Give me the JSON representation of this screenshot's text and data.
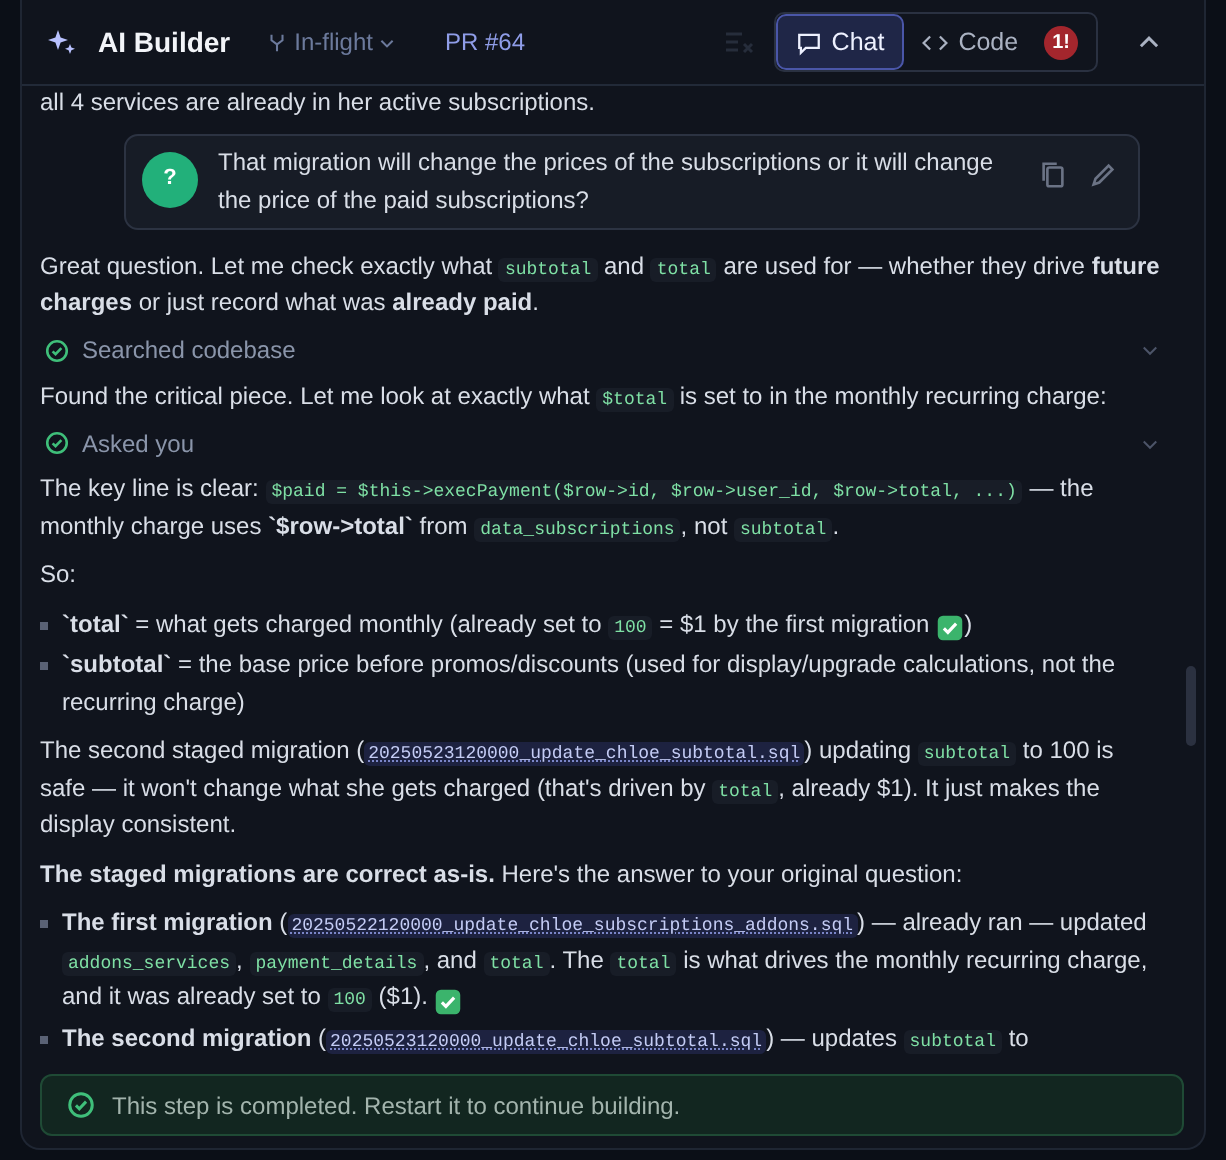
{
  "header": {
    "title": "AI Builder",
    "branch": "In-flight",
    "pr_label": "PR",
    "pr_number": "#64",
    "tabs": [
      {
        "label": "Chat",
        "selected": true
      },
      {
        "label": "Code",
        "selected": false,
        "badge": "1!"
      }
    ]
  },
  "blocks": [
    {
      "kind": "text",
      "segments": [
        {
          "kind": "text",
          "text": "all 4 services are already in her active subscriptions."
        }
      ]
    },
    {
      "kind": "question",
      "avatar": "?",
      "text": "That migration will change the prices of the subscriptions or it will change the price of the paid subscriptions?"
    },
    {
      "kind": "text",
      "segments": [
        {
          "kind": "text",
          "text": "Great question. Let me check exactly what "
        },
        {
          "kind": "code",
          "text": "subtotal"
        },
        {
          "kind": "text",
          "text": " and "
        },
        {
          "kind": "code",
          "text": "total"
        },
        {
          "kind": "text",
          "text": " are used for — whether they drive **future charges** or just record what was **already paid**."
        }
      ]
    },
    {
      "kind": "step",
      "label": "Searched codebase",
      "expanded": false
    },
    {
      "kind": "text",
      "segments": [
        {
          "kind": "text",
          "text": "Found the critical piece. Let me look at exactly what "
        },
        {
          "kind": "code",
          "text": "$total"
        },
        {
          "kind": "text",
          "text": " is set to in the monthly recurring charge:"
        }
      ]
    },
    {
      "kind": "step",
      "label": "Asked you",
      "expanded": false
    },
    {
      "kind": "text",
      "segments": [
        {
          "kind": "text",
          "text": "The key line is clear: "
        },
        {
          "kind": "code",
          "text": "$paid = $this->execPayment($row->id, $row->user_id, $row->total, ...)"
        },
        {
          "kind": "text",
          "text": " — the monthly charge uses **`$row->total`** from "
        },
        {
          "kind": "code",
          "text": "data_subscriptions"
        },
        {
          "kind": "text",
          "text": ", not "
        },
        {
          "kind": "code",
          "text": "subtotal"
        },
        {
          "kind": "text",
          "text": "."
        }
      ]
    },
    {
      "kind": "text",
      "segments": [
        {
          "kind": "text",
          "text": "So:"
        }
      ]
    },
    {
      "kind": "list",
      "items": [
        {
          "segments": [
            {
              "kind": "text",
              "text": "**`total`** = what gets charged monthly (already set to "
            },
            {
              "kind": "code",
              "text": "100"
            },
            {
              "kind": "text",
              "text": " = $1 by the first migration "
            },
            {
              "kind": "check"
            },
            {
              "kind": "text",
              "text": ")"
            }
          ]
        },
        {
          "segments": [
            {
              "kind": "text",
              "text": "**`subtotal`** = the base price before promos/discounts (used for display/upgrade calculations, not the recurring charge)"
            }
          ]
        }
      ]
    },
    {
      "kind": "text",
      "segments": [
        {
          "kind": "text",
          "text": "The second staged migration ("
        },
        {
          "kind": "file",
          "text": "20250523120000_update_chloe_subtotal.sql"
        },
        {
          "kind": "text",
          "text": ") updating "
        },
        {
          "kind": "code",
          "text": "subtotal"
        },
        {
          "kind": "text",
          "text": " to 100 is safe — it won't change what she gets charged (that's driven by "
        },
        {
          "kind": "code",
          "text": "total"
        },
        {
          "kind": "text",
          "text": ", already $1). It just makes the display consistent."
        }
      ]
    },
    {
      "kind": "text",
      "segments": [
        {
          "kind": "text",
          "text": "**The staged migrations are correct as-is.** Here's the answer to your original question:"
        }
      ]
    },
    {
      "kind": "list",
      "items": [
        {
          "segments": [
            {
              "kind": "text",
              "text": "**The first migration** ("
            },
            {
              "kind": "file",
              "text": "20250522120000_update_chloe_subscriptions_addons.sql"
            },
            {
              "kind": "text",
              "text": ") — already ran — updated "
            },
            {
              "kind": "code",
              "text": "addons_services"
            },
            {
              "kind": "text",
              "text": ", "
            },
            {
              "kind": "code",
              "text": "payment_details"
            },
            {
              "kind": "text",
              "text": ", and "
            },
            {
              "kind": "code",
              "text": "total"
            },
            {
              "kind": "text",
              "text": ". The "
            },
            {
              "kind": "code",
              "text": "total"
            },
            {
              "kind": "text",
              "text": " is what drives the monthly recurring charge, and it was already set to "
            },
            {
              "kind": "code",
              "text": "100"
            },
            {
              "kind": "text",
              "text": " ($1). "
            },
            {
              "kind": "check"
            }
          ]
        },
        {
          "segments": [
            {
              "kind": "text",
              "text": "**The second migration** ("
            },
            {
              "kind": "file",
              "text": "20250523120000_update_chloe_subtotal.sql"
            },
            {
              "kind": "text",
              "text": ") — updates "
            },
            {
              "kind": "code",
              "text": "subtotal"
            },
            {
              "kind": "text",
              "text": " to"
            }
          ]
        }
      ]
    }
  ],
  "notice": {
    "text": "This step is completed. Restart it to continue building."
  }
}
